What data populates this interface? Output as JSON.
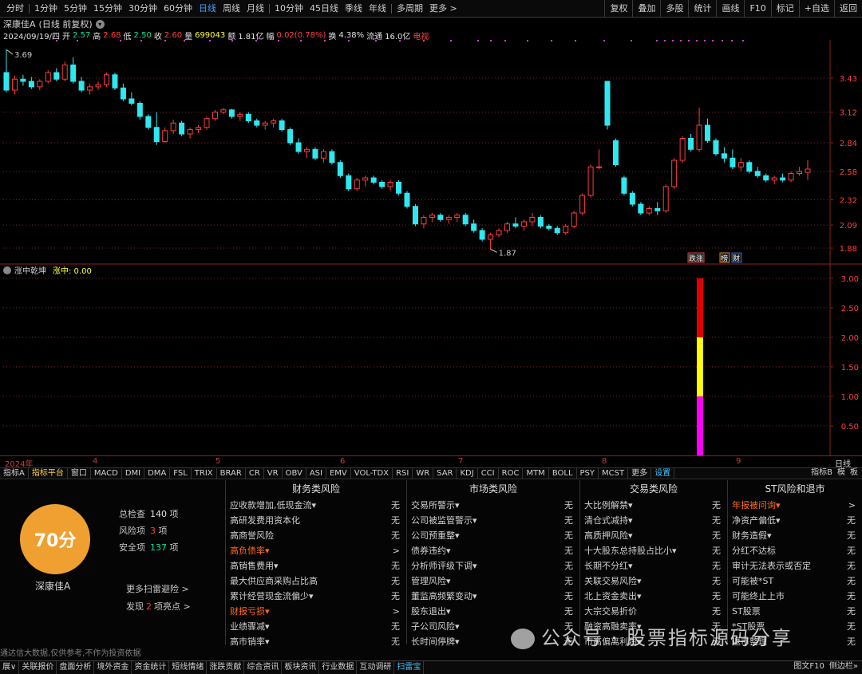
{
  "toolbar": {
    "periods": [
      "分时",
      "1分钟",
      "5分钟",
      "15分钟",
      "30分钟",
      "60分钟",
      "日线",
      "周线",
      "月线",
      "10分钟",
      "45日线",
      "季线",
      "年线",
      "多周期",
      "更多 >"
    ],
    "active_period": "日线",
    "right_buttons": [
      "复权",
      "叠加",
      "多股",
      "统计",
      "画线",
      "F10",
      "标记",
      "+自选",
      "返回"
    ]
  },
  "quote": {
    "name": "深康佳A",
    "mode": "(日线 前复权)",
    "date": "2024/09/19/四",
    "open_label": "开",
    "open": "2.57",
    "high_label": "高",
    "high": "2.68",
    "low_label": "低",
    "low": "2.50",
    "close_label": "收",
    "close": "2.60",
    "volume_label": "量",
    "volume": "699043",
    "amount_label": "额",
    "amount": "1.81亿",
    "change_label": "幅",
    "change": "0.02(0.78%)",
    "turnover_label": "换",
    "turnover": "4.38%",
    "float_label": "流通",
    "float": "16.0亿",
    "tag": "电视"
  },
  "price_axis": [
    "3.43",
    "3.12",
    "2.84",
    "2.58",
    "2.32",
    "2.09",
    "1.88"
  ],
  "markers": {
    "high": "3.69",
    "low": "1.87"
  },
  "event_tags": [
    "跌涨",
    "榜",
    "财"
  ],
  "indicator": {
    "name": "涨中乾坤",
    "value_label": "涨中: 0.00",
    "axis": [
      "3.00",
      "2.50",
      "2.00",
      "1.50",
      "1.00",
      "0.50"
    ]
  },
  "date_axis": {
    "year": "2024年",
    "months": [
      "4",
      "5",
      "6",
      "7",
      "8",
      "9"
    ],
    "period_label": "日线"
  },
  "indicator_tabs": [
    "指标A",
    "指标平台",
    "窗口",
    "MACD",
    "DMI",
    "DMA",
    "FSL",
    "TRIX",
    "BRAR",
    "CR",
    "VR",
    "OBV",
    "ASI",
    "EMV",
    "VOL-TDX",
    "RSI",
    "WR",
    "SAR",
    "KDJ",
    "CCI",
    "ROC",
    "MTM",
    "BOLL",
    "PSY",
    "MCST",
    "更多",
    "设置"
  ],
  "indicator_tabs_right": [
    "指标B",
    "模",
    "板"
  ],
  "scan": {
    "score": "70分",
    "stock": "深康佳A",
    "total_label": "总检查",
    "total": "140",
    "total_unit": "项",
    "risk_label": "风险项",
    "risk": "3",
    "risk_unit": "项",
    "safe_label": "安全项",
    "safe": "137",
    "safe_unit": "项",
    "more": "更多扫雷避险 >",
    "highlight_prefix": "发现",
    "highlight_num": "2",
    "highlight_suffix": "项亮点 >",
    "disclaimer": "通达信大数据,仅供参考,不作为投资依据",
    "columns": [
      {
        "title": "财务类风险",
        "items": [
          {
            "label": "应收款增加,低现金流▾",
            "value": "无",
            "alert": false
          },
          {
            "label": "高研发费用资本化",
            "value": "无",
            "alert": false
          },
          {
            "label": "高商誉风险",
            "value": "无",
            "alert": false
          },
          {
            "label": "高负债率▾",
            "value": ">",
            "alert": true
          },
          {
            "label": "高销售费用▾",
            "value": "无",
            "alert": false
          },
          {
            "label": "最大供应商采购占比高",
            "value": "无",
            "alert": false
          },
          {
            "label": "累计经营现金流偏少▾",
            "value": "无",
            "alert": false
          },
          {
            "label": "财报亏损▾",
            "value": ">",
            "alert": true
          },
          {
            "label": "业绩骤减▾",
            "value": "无",
            "alert": false
          },
          {
            "label": "高市销率▾",
            "value": "无",
            "alert": false
          }
        ]
      },
      {
        "title": "市场类风险",
        "items": [
          {
            "label": "交易所警示▾",
            "value": "无",
            "alert": false
          },
          {
            "label": "公司被监管警示▾",
            "value": "无",
            "alert": false
          },
          {
            "label": "公司预重整▾",
            "value": "无",
            "alert": false
          },
          {
            "label": "债券违约▾",
            "value": "无",
            "alert": false
          },
          {
            "label": "分析师评级下调▾",
            "value": "无",
            "alert": false
          },
          {
            "label": "管理风险▾",
            "value": "无",
            "alert": false
          },
          {
            "label": "董监高频繁变动▾",
            "value": "无",
            "alert": false
          },
          {
            "label": "股东退出▾",
            "value": "无",
            "alert": false
          },
          {
            "label": "子公司风险▾",
            "value": "无",
            "alert": false
          },
          {
            "label": "长时间停牌▾",
            "value": "无",
            "alert": false
          }
        ]
      },
      {
        "title": "交易类风险",
        "items": [
          {
            "label": "大比例解禁▾",
            "value": "无",
            "alert": false
          },
          {
            "label": "清仓式减持▾",
            "value": "无",
            "alert": false
          },
          {
            "label": "高质押风险▾",
            "value": "无",
            "alert": false
          },
          {
            "label": "十大股东总持股占比小▾",
            "value": "无",
            "alert": false
          },
          {
            "label": "长期不分红▾",
            "value": "无",
            "alert": false
          },
          {
            "label": "关联交易风险▾",
            "value": "无",
            "alert": false
          },
          {
            "label": "北上资金卖出▾",
            "value": "无",
            "alert": false
          },
          {
            "label": "大宗交易折价",
            "value": "无",
            "alert": false
          },
          {
            "label": "融资高融卖率▾",
            "value": "无",
            "alert": false
          },
          {
            "label": "市高偏离利润▾",
            "value": "无",
            "alert": false
          }
        ]
      },
      {
        "title": "ST风险和退市",
        "items": [
          {
            "label": "年报被问询▾",
            "value": ">",
            "alert": true
          },
          {
            "label": "净资产偏低▾",
            "value": "无",
            "alert": false
          },
          {
            "label": "财务造假▾",
            "value": "无",
            "alert": false
          },
          {
            "label": "分红不达标",
            "value": "无",
            "alert": false
          },
          {
            "label": "审计无法表示或否定",
            "value": "无",
            "alert": false
          },
          {
            "label": "可能被*ST",
            "value": "无",
            "alert": false
          },
          {
            "label": "可能终止上市",
            "value": "无",
            "alert": false
          },
          {
            "label": "ST股票",
            "value": "无",
            "alert": false
          },
          {
            "label": "*ST股票",
            "value": "无",
            "alert": false
          },
          {
            "label": "退市整理",
            "value": "无",
            "alert": false
          }
        ]
      }
    ]
  },
  "statusbar": [
    "展∨",
    "关联报价",
    "盘面分析",
    "境外资金",
    "资金统计",
    "短线情绪",
    "涨跌贡献",
    "综合资讯",
    "板块资讯",
    "行业数据",
    "互动调研",
    "扫雷宝"
  ],
  "statusbar_active": "扫雷宝",
  "statusbar_right": [
    "图文F10",
    "侧边栏»"
  ],
  "watermark": "公众号 · 股票指标源码分享",
  "colors": {
    "up": "#ff3c3c",
    "down": "#2ee8f0",
    "grid": "#8a2020",
    "bar_red": "#e00000",
    "bar_yellow": "#ffff00",
    "bar_magenta": "#ff00ff",
    "score": "#f0a030"
  },
  "chart_data": [
    {
      "type": "candlestick",
      "title": "深康佳A (日线 前复权)",
      "ylim": [
        1.8,
        3.72
      ],
      "grid": true,
      "candles": [
        [
          3.48,
          3.69,
          3.3,
          3.32
        ],
        [
          3.32,
          3.45,
          3.28,
          3.42
        ],
        [
          3.42,
          3.46,
          3.36,
          3.4
        ],
        [
          3.4,
          3.44,
          3.33,
          3.35
        ],
        [
          3.35,
          3.42,
          3.32,
          3.4
        ],
        [
          3.4,
          3.5,
          3.38,
          3.48
        ],
        [
          3.48,
          3.52,
          3.4,
          3.42
        ],
        [
          3.42,
          3.58,
          3.4,
          3.55
        ],
        [
          3.55,
          3.62,
          3.38,
          3.4
        ],
        [
          3.4,
          3.44,
          3.3,
          3.32
        ],
        [
          3.32,
          3.38,
          3.28,
          3.35
        ],
        [
          3.35,
          3.4,
          3.32,
          3.37
        ],
        [
          3.37,
          3.48,
          3.35,
          3.46
        ],
        [
          3.46,
          3.48,
          3.32,
          3.34
        ],
        [
          3.34,
          3.38,
          3.22,
          3.24
        ],
        [
          3.24,
          3.3,
          3.18,
          3.2
        ],
        [
          3.2,
          3.22,
          3.05,
          3.08
        ],
        [
          3.08,
          3.1,
          2.96,
          2.98
        ],
        [
          2.98,
          3.12,
          2.82,
          2.85
        ],
        [
          2.85,
          2.98,
          2.84,
          2.95
        ],
        [
          2.95,
          3.05,
          2.92,
          3.02
        ],
        [
          3.02,
          3.04,
          2.9,
          2.92
        ],
        [
          2.92,
          2.98,
          2.88,
          2.96
        ],
        [
          2.96,
          3.0,
          2.93,
          2.98
        ],
        [
          2.98,
          3.08,
          2.96,
          3.06
        ],
        [
          3.06,
          3.14,
          3.04,
          3.12
        ],
        [
          3.12,
          3.16,
          3.1,
          3.14
        ],
        [
          3.14,
          3.15,
          3.06,
          3.08
        ],
        [
          3.08,
          3.12,
          3.04,
          3.1
        ],
        [
          3.1,
          3.12,
          3.02,
          3.04
        ],
        [
          3.04,
          3.06,
          2.98,
          3.0
        ],
        [
          3.0,
          3.04,
          2.96,
          3.02
        ],
        [
          3.02,
          3.06,
          2.98,
          3.04
        ],
        [
          3.04,
          3.06,
          2.94,
          2.96
        ],
        [
          2.96,
          2.98,
          2.82,
          2.84
        ],
        [
          2.84,
          2.88,
          2.74,
          2.76
        ],
        [
          2.76,
          2.8,
          2.7,
          2.78
        ],
        [
          2.78,
          2.8,
          2.68,
          2.7
        ],
        [
          2.7,
          2.78,
          2.66,
          2.76
        ],
        [
          2.76,
          2.78,
          2.64,
          2.66
        ],
        [
          2.66,
          2.68,
          2.52,
          2.54
        ],
        [
          2.54,
          2.56,
          2.4,
          2.42
        ],
        [
          2.42,
          2.52,
          2.4,
          2.5
        ],
        [
          2.5,
          2.54,
          2.44,
          2.52
        ],
        [
          2.52,
          2.54,
          2.46,
          2.48
        ],
        [
          2.48,
          2.5,
          2.42,
          2.44
        ],
        [
          2.44,
          2.5,
          2.4,
          2.48
        ],
        [
          2.48,
          2.5,
          2.36,
          2.38
        ],
        [
          2.38,
          2.4,
          2.24,
          2.26
        ],
        [
          2.26,
          2.28,
          2.08,
          2.1
        ],
        [
          2.1,
          2.18,
          2.06,
          2.16
        ],
        [
          2.16,
          2.2,
          2.12,
          2.18
        ],
        [
          2.18,
          2.2,
          2.12,
          2.14
        ],
        [
          2.14,
          2.18,
          2.1,
          2.16
        ],
        [
          2.16,
          2.2,
          2.12,
          2.18
        ],
        [
          2.18,
          2.2,
          2.08,
          2.1
        ],
        [
          2.1,
          2.14,
          2.02,
          2.04
        ],
        [
          2.04,
          2.06,
          1.94,
          1.96
        ],
        [
          1.96,
          2.02,
          1.87,
          2.0
        ],
        [
          2.0,
          2.06,
          1.98,
          2.04
        ],
        [
          2.04,
          2.12,
          2.02,
          2.1
        ],
        [
          2.1,
          2.16,
          2.06,
          2.08
        ],
        [
          2.08,
          2.14,
          2.04,
          2.12
        ],
        [
          2.12,
          2.2,
          2.08,
          2.16
        ],
        [
          2.16,
          2.18,
          2.06,
          2.08
        ],
        [
          2.08,
          2.1,
          2.04,
          2.06
        ],
        [
          2.06,
          2.08,
          2.0,
          2.02
        ],
        [
          2.02,
          2.1,
          2.0,
          2.08
        ],
        [
          2.08,
          2.22,
          2.06,
          2.2
        ],
        [
          2.2,
          2.38,
          2.18,
          2.36
        ],
        [
          2.36,
          2.64,
          2.34,
          2.62
        ],
        [
          2.62,
          2.78,
          2.6,
          2.62
        ],
        [
          3.4,
          3.4,
          2.96,
          3.0
        ],
        [
          2.86,
          2.88,
          2.62,
          2.64
        ],
        [
          2.52,
          2.54,
          2.36,
          2.38
        ],
        [
          2.38,
          2.4,
          2.26,
          2.28
        ],
        [
          2.28,
          2.3,
          2.18,
          2.2
        ],
        [
          2.2,
          2.26,
          2.18,
          2.24
        ],
        [
          2.24,
          2.3,
          2.18,
          2.22
        ],
        [
          2.22,
          2.46,
          2.2,
          2.44
        ],
        [
          2.44,
          2.7,
          2.42,
          2.68
        ],
        [
          2.68,
          2.9,
          2.66,
          2.88
        ],
        [
          2.88,
          2.92,
          2.76,
          2.78
        ],
        [
          2.78,
          3.16,
          2.76,
          3.0
        ],
        [
          3.0,
          3.06,
          2.84,
          2.86
        ],
        [
          2.86,
          2.88,
          2.72,
          2.74
        ],
        [
          2.74,
          2.8,
          2.66,
          2.7
        ],
        [
          2.7,
          2.78,
          2.6,
          2.62
        ],
        [
          2.62,
          2.7,
          2.58,
          2.66
        ],
        [
          2.66,
          2.68,
          2.56,
          2.58
        ],
        [
          2.58,
          2.62,
          2.52,
          2.54
        ],
        [
          2.54,
          2.56,
          2.48,
          2.5
        ],
        [
          2.5,
          2.54,
          2.46,
          2.52
        ],
        [
          2.52,
          2.56,
          2.48,
          2.5
        ],
        [
          2.5,
          2.58,
          2.48,
          2.56
        ],
        [
          2.56,
          2.62,
          2.54,
          2.58
        ],
        [
          2.57,
          2.68,
          2.5,
          2.6
        ]
      ]
    },
    {
      "type": "bar",
      "title": "涨中乾坤",
      "ylim": [
        0,
        3.2
      ],
      "segments": [
        {
          "from": 0,
          "to": 1,
          "color": "#ff00ff"
        },
        {
          "from": 1,
          "to": 2,
          "color": "#ffff00"
        },
        {
          "from": 2,
          "to": 3,
          "color": "#e00000"
        }
      ]
    }
  ]
}
